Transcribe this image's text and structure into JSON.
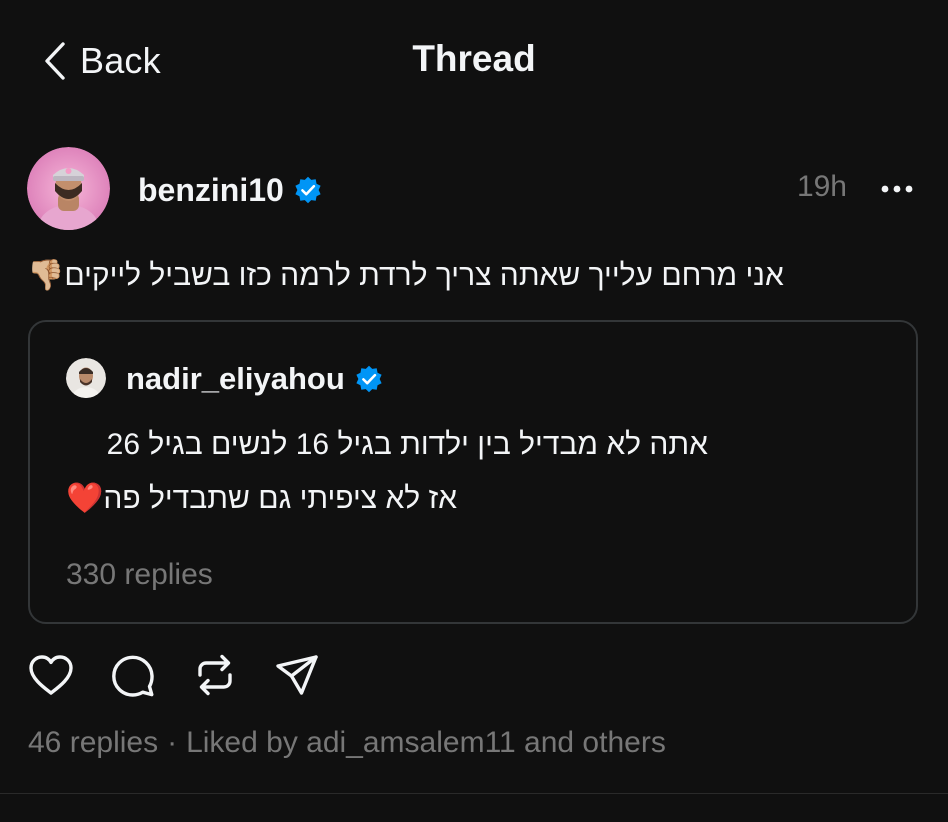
{
  "header": {
    "back_label": "Back",
    "title": "Thread"
  },
  "post": {
    "author": "benzini10",
    "verified": true,
    "timestamp": "19h",
    "text": "אני מרחם עלייך שאתה צריך לרדת לרמה כזו בשביל לייקים👎🏼",
    "quoted": {
      "author": "nadir_eliyahou",
      "verified": true,
      "lines": [
        "אתה לא מבדיל בין ילדות בגיל 16 לנשים בגיל 26",
        "אז לא ציפיתי גם שתבדיל פה❤️"
      ],
      "replies": "330 replies"
    },
    "actions": [
      "heart-icon",
      "comment-icon",
      "repost-icon",
      "share-icon"
    ],
    "replies": "46 replies",
    "separator": "·",
    "liked_by": "Liked by adi_amsalem11 and others"
  },
  "colors": {
    "background": "#101010",
    "text": "#f3f5f7",
    "secondary": "#777777",
    "border": "#333638",
    "verified": "#0095f6"
  }
}
